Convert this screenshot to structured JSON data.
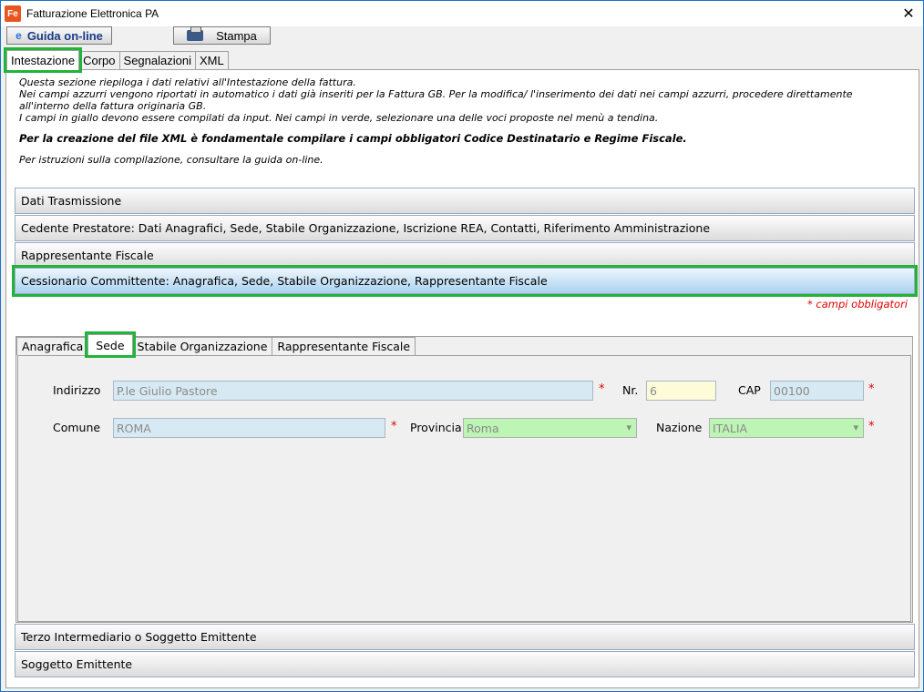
{
  "window": {
    "title": "Fatturazione Elettronica PA",
    "icon": "Fe"
  },
  "toolbar": {
    "guida_label": "Guida on-line",
    "stampa_label": "Stampa"
  },
  "main_tabs": [
    "Intestazione",
    "Corpo",
    "Segnalazioni",
    "XML"
  ],
  "info": {
    "line1": "Questa sezione riepiloga i dati relativi all'Intestazione della fattura.",
    "line2": "Nei campi azzurri vengono riportati in automatico i dati già inseriti per la Fattura GB. Per la modifica/ l'inserimento dei dati nei campi azzurri, procedere direttamente all'interno della fattura originaria GB.",
    "line3": "I campi in giallo devono essere compilati da input. Nei campi in verde, selezionare una delle voci proposte nel menù a tendina.",
    "bold": "Per la creazione del file XML è fondamentale compilare i campi obbligatori Codice Destinatario e Regime Fiscale.",
    "last": "Per istruzioni sulla compilazione, consultare la guida on-line."
  },
  "sections": {
    "dati_trasmissione": "Dati Trasmissione",
    "cedente": "Cedente Prestatore: Dati Anagrafici, Sede, Stabile Organizzazione, Iscrizione REA, Contatti, Riferimento Amministrazione",
    "rappresentante": "Rappresentante Fiscale",
    "cessionario": "Cessionario Committente: Anagrafica, Sede, Stabile Organizzazione, Rappresentante Fiscale",
    "terzo": "Terzo Intermediario o Soggetto Emittente",
    "soggetto": "Soggetto Emittente"
  },
  "required_note": "* campi obbligatori",
  "sub_tabs": [
    "Anagrafica",
    "Sede",
    "Stabile Organizzazione",
    "Rappresentante Fiscale"
  ],
  "form": {
    "indirizzo_label": "Indirizzo",
    "indirizzo_value": "P.le Giulio Pastore",
    "nr_label": "Nr.",
    "nr_value": "6",
    "cap_label": "CAP",
    "cap_value": "00100",
    "comune_label": "Comune",
    "comune_value": "ROMA",
    "provincia_label": "Provincia",
    "provincia_value": "Roma",
    "nazione_label": "Nazione",
    "nazione_value": "ITALIA",
    "req_mark": "*"
  },
  "colors": {
    "required": "#e00000",
    "highlight": "#22b33a",
    "blue_field": "#d7eaf3",
    "yellow_field": "#fdfbd8",
    "green_field": "#bdf5b4"
  }
}
